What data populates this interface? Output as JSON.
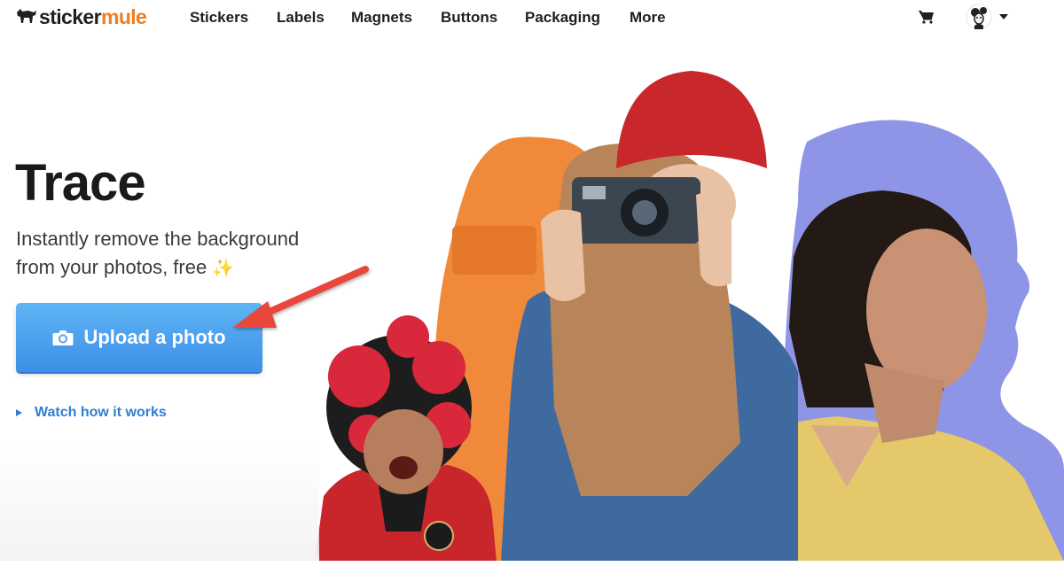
{
  "brand": {
    "name_part1": "sticker",
    "name_part2": "mule",
    "accent": "#ef7d22"
  },
  "nav": {
    "items": [
      {
        "label": "Stickers"
      },
      {
        "label": "Labels"
      },
      {
        "label": "Magnets"
      },
      {
        "label": "Buttons"
      },
      {
        "label": "Packaging"
      },
      {
        "label": "More"
      }
    ],
    "cart_icon": "cart-icon",
    "avatar_icon": "user-avatar",
    "menu_icon": "caret-down-icon"
  },
  "hero": {
    "title": "Trace",
    "subtitle_line1": "Instantly remove the background",
    "subtitle_line2": "from your photos, free",
    "sparkle": "✨",
    "upload_label": "Upload a photo",
    "upload_icon": "camera-icon",
    "watch_label": "Watch how it works",
    "annotation": "red-arrow-pointing-at-upload-button"
  },
  "colors": {
    "button_top": "#5fb4f4",
    "button_bottom": "#3d8fe8",
    "link": "#2f7fd1",
    "orange_silhouette": "#f08a3a",
    "purple_silhouette": "#8f95e6"
  }
}
